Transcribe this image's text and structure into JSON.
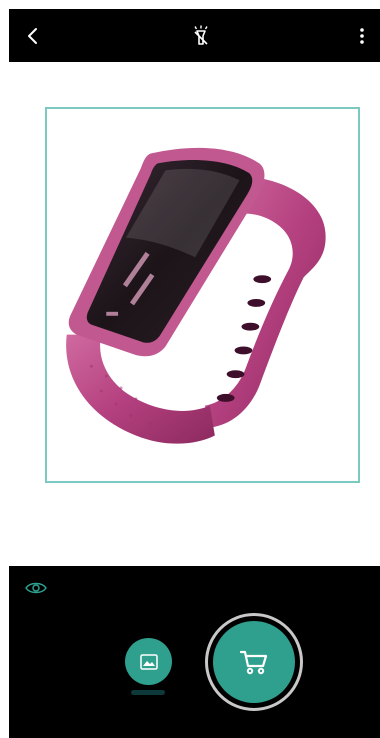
{
  "app": {
    "accent": "#2f9f8e",
    "frame_color": "#7cc9c1",
    "band_color": "#b4407f"
  },
  "topbar": {
    "back_icon": "chevron-left-icon",
    "flash_icon": "flash-off-icon",
    "menu_icon": "more-vertical-icon"
  },
  "viewport": {
    "detected_object": "fitness-band-image"
  },
  "bottombar": {
    "lens_icon": "eye-icon",
    "gallery_icon": "gallery-image-icon",
    "shutter_icon": "shopping-cart-icon"
  }
}
